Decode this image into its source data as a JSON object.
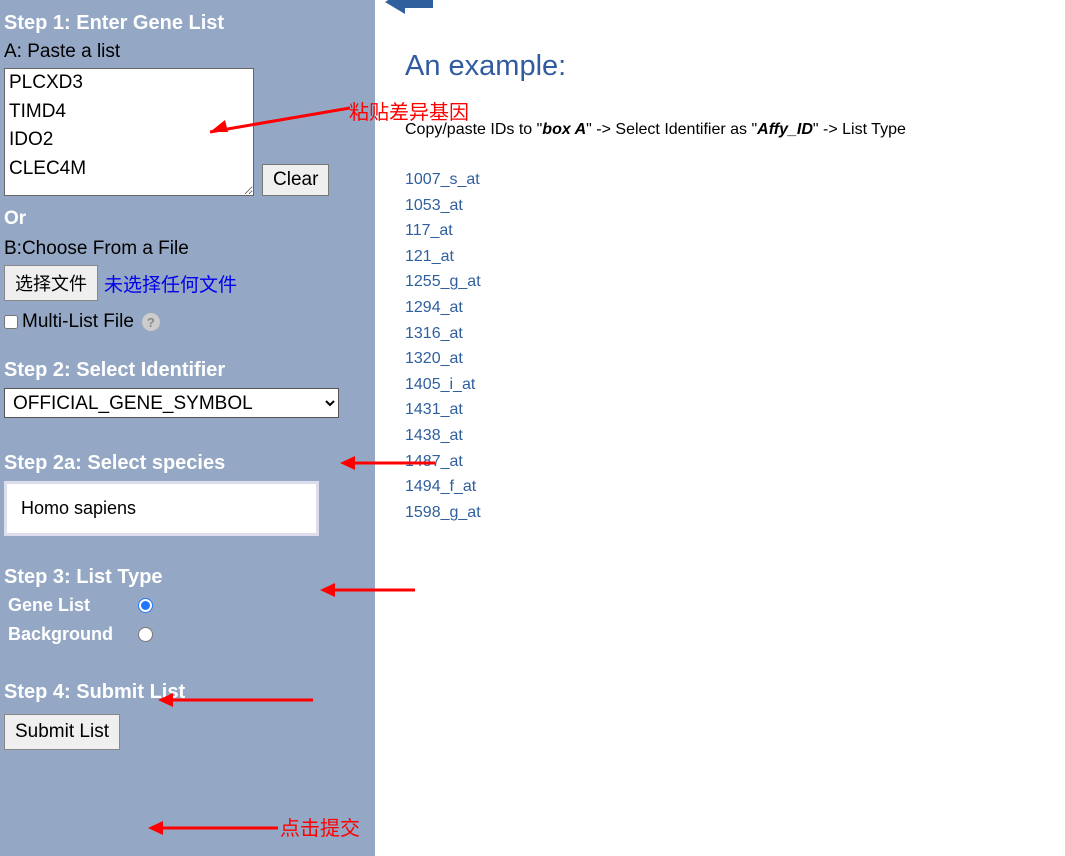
{
  "left": {
    "step1": {
      "title": "Step 1: Enter Gene List",
      "labelA": "A: Paste a list",
      "textarea": "PLCXD3\nTIMD4\nIDO2\nCLEC4M",
      "clear": "Clear",
      "or": "Or",
      "labelB": "B:Choose From a File",
      "fileBtn": "选择文件",
      "fileStatus": "未选择任何文件",
      "multi": "Multi-List File"
    },
    "step2": {
      "title": "Step 2: Select Identifier",
      "value": "OFFICIAL_GENE_SYMBOL"
    },
    "step2a": {
      "title": "Step 2a: Select species",
      "value": "Homo sapiens"
    },
    "step3": {
      "title": "Step 3: List Type",
      "opt1": "Gene List",
      "opt2": "Background"
    },
    "step4": {
      "title": "Step 4: Submit List",
      "btn": "Submit List"
    }
  },
  "right": {
    "heading": "An example:",
    "instr_pre": "Copy/paste IDs to \"",
    "instr_boxa": "box A",
    "instr_mid": "\" -> Select Identifier as  \"",
    "instr_affy": "Affy_ID",
    "instr_post": "\" -> List Type",
    "ids": [
      "1007_s_at",
      "1053_at",
      "117_at",
      "121_at",
      "1255_g_at",
      "1294_at",
      "1316_at",
      "1320_at",
      "1405_i_at",
      "1431_at",
      "1438_at",
      "1487_at",
      "1494_f_at",
      "1598_g_at"
    ]
  },
  "annot": {
    "a1": "粘贴差异基因",
    "a2": "点击提交"
  }
}
